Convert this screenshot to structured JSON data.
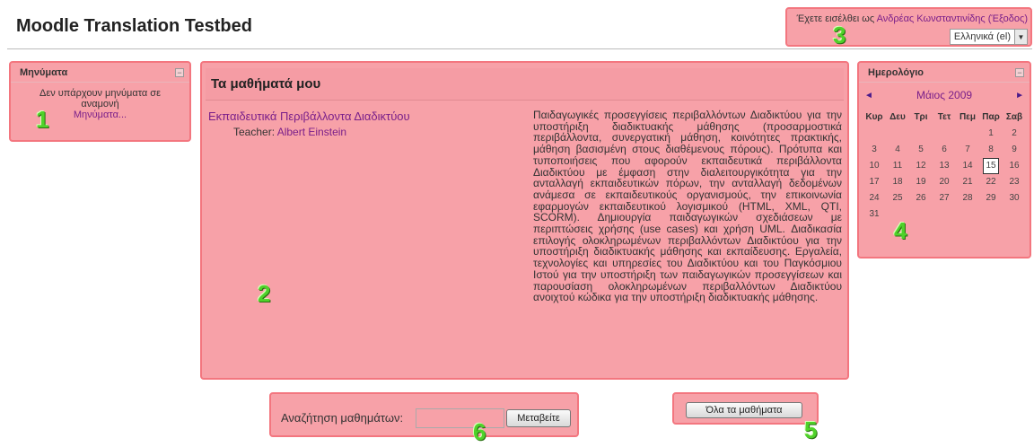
{
  "site": {
    "title": "Moodle Translation Testbed"
  },
  "login": {
    "prefix": "Έχετε εισέλθει ως ",
    "user": "Ανδρέας Κωνσταντινίδης",
    "logout": "(Έξοδος)",
    "language": "Ελληνικά (el)"
  },
  "messages_block": {
    "title": "Μηνύματα",
    "empty_text": "Δεν υπάρχουν μηνύματα σε αναμονή",
    "link": "Μηνύματα..."
  },
  "courses_block": {
    "title": "Τα μαθήματά μου",
    "course": {
      "name": "Εκπαιδευτικά Περιβάλλοντα Διαδικτύου",
      "teacher_label": "Teacher: ",
      "teacher_name": "Albert Einstein",
      "summary": "Παιδαγωγικές προσεγγίσεις περιβαλλόντων Διαδικτύου για την υποστήριξη διαδικτυακής μάθησης (προσαρμοστικά περιβάλλοντα, συνεργατική μάθηση, κοινότητες πρακτικής, μάθηση βασισμένη στους διαθέμενους πόρους). Πρότυπα και τυποποιήσεις που αφορούν εκπαιδευτικά περιβάλλοντα Διαδικτύου με έμφαση στην διαλειτουργικότητα για την ανταλλαγή εκπαιδευτικών πόρων, την ανταλλαγή δεδομένων ανάμεσα σε εκπαιδευτικούς οργανισμούς, την επικοινωνία εφαρμογών εκπαιδευτικού λογισμικού (HTML, XML, QTI, SCORM). Δημιουργία παιδαγωγικών σχεδιάσεων με περιπτώσεις χρήσης (use cases) και χρήση UML. Διαδικασία επιλογής ολοκληρωμένων περιβαλλόντων Διαδικτύου για την υποστήριξη διαδικτυακής μάθησης και εκπαίδευσης. Εργαλεία, τεχνολογίες και υπηρεσίες του Διαδικτύου και του Παγκόσμιου Ιστού για την υποστήριξη των παιδαγωγικών προσεγγίσεων και παρουσίαση ολοκληρωμένων περιβαλλόντων Διαδικτύου ανοιχτού κώδικα για την υποστήριξη διαδικτυακής μάθησης."
    }
  },
  "calendar": {
    "title": "Ημερολόγιο",
    "month": "Μάιος 2009",
    "prev_arrow": "◄",
    "next_arrow": "►",
    "weekdays": [
      "Κυρ",
      "Δευ",
      "Τρι",
      "Τετ",
      "Πεμ",
      "Παρ",
      "Σαβ"
    ],
    "cells": [
      "",
      "",
      "",
      "",
      "",
      "1",
      "2",
      "3",
      "4",
      "5",
      "6",
      "7",
      "8",
      "9",
      "10",
      "11",
      "12",
      "13",
      "14",
      "15",
      "16",
      "17",
      "18",
      "19",
      "20",
      "21",
      "22",
      "23",
      "24",
      "25",
      "26",
      "27",
      "28",
      "29",
      "30",
      "31",
      "",
      "",
      "",
      "",
      "",
      ""
    ],
    "today": "15"
  },
  "search": {
    "label": "Αναζήτηση μαθημάτων:",
    "value": "",
    "button": "Μεταβείτε"
  },
  "all_courses_button": "Όλα τα μαθήματα",
  "markers": [
    "1",
    "2",
    "3",
    "4",
    "5",
    "6"
  ],
  "colors": {
    "highlight": "#f7a1a8",
    "marker": "#4fd22a",
    "link": "#7a1f8a"
  },
  "icons": {
    "block_hide": "minus-box-icon",
    "select_arrow": "chevron-down-icon"
  }
}
